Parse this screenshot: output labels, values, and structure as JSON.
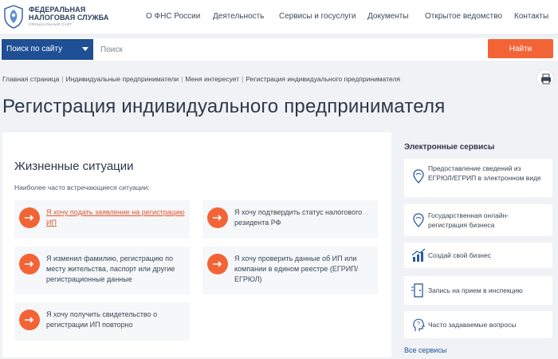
{
  "header": {
    "org_line1": "ФЕДЕРАЛЬНАЯ",
    "org_line2": "НАЛОГОВАЯ СЛУЖБА",
    "org_sub": "ОФИЦИАЛЬНЫЙ САЙТ",
    "nav": [
      "О ФНС России",
      "Деятельность",
      "Сервисы и госуслуги",
      "Документы",
      "Открытое ведомство",
      "Контакты"
    ]
  },
  "search": {
    "scope": "Поиск по сайту",
    "placeholder": "Поиск",
    "button": "Найти"
  },
  "breadcrumb": [
    "Главная страница",
    "Индивидуальные предприниматели",
    "Меня интересует",
    "Регистрация индивидуального предпринимателя"
  ],
  "page_title": "Регистрация индивидуального предпринимателя",
  "main": {
    "title": "Жизненные ситуации",
    "subtitle": "Наиболее часто встречающиеся ситуации:",
    "situations": [
      "Я хочу подать заявление на регистрацию ИП",
      "Я хочу подтвердить статус налогового резидента РФ",
      "Я изменил фамилию, регистрацию по месту жительства, паспорт или другие регистрационные данные",
      "Я хочу проверить данные об ИП или компании в едином реестре (ЕГРИП/ЕГРЮЛ)",
      "Я хочу получить свидетельство о регистрации ИП повторно"
    ]
  },
  "sidebar": {
    "title": "Электронные сервисы",
    "services": [
      {
        "label": "Предоставление сведений из ЕГРЮЛ/ЕГРИП в электронном виде",
        "icon": "location-pin-icon"
      },
      {
        "label": "Государственная онлайн-регистрация бизнеса",
        "icon": "location-pin-icon"
      },
      {
        "label": "Создай свой бизнес",
        "icon": "growth-chart-icon"
      },
      {
        "label": "Запись на прием в инспекцию",
        "icon": "door-icon"
      },
      {
        "label": "Часто задаваемые вопросы",
        "icon": "question-head-icon"
      }
    ],
    "all_link": "Все сервисы"
  },
  "colors": {
    "accent": "#f26436",
    "brand": "#1f4f94",
    "background": "#f1f2f5"
  }
}
